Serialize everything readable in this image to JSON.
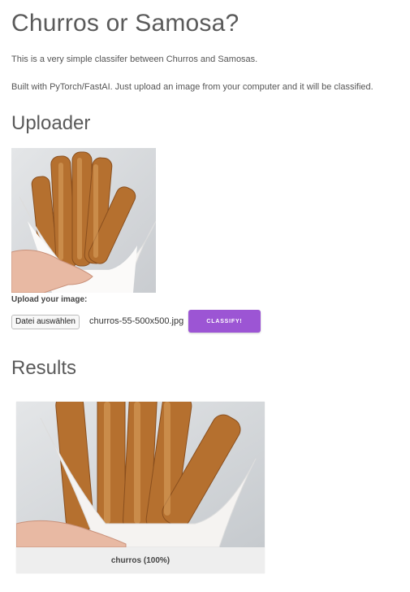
{
  "page": {
    "title": "Churros or Samosa?",
    "description_1": "This is a very simple classifer between Churros and Samosas.",
    "description_2": "Built with PyTorch/FastAI. Just upload an image from your computer and it will be classified."
  },
  "uploader": {
    "heading": "Uploader",
    "preview_image": "churros-photo",
    "label": "Upload your image:",
    "file_button_label": "Datei auswählen",
    "file_name": "churros-55-500x500.jpg",
    "classify_label": "CLASSIFY!",
    "accent_color": "#9c55d4"
  },
  "results": {
    "heading": "Results",
    "result_image": "churros-photo",
    "prediction": "churros (100%)"
  }
}
